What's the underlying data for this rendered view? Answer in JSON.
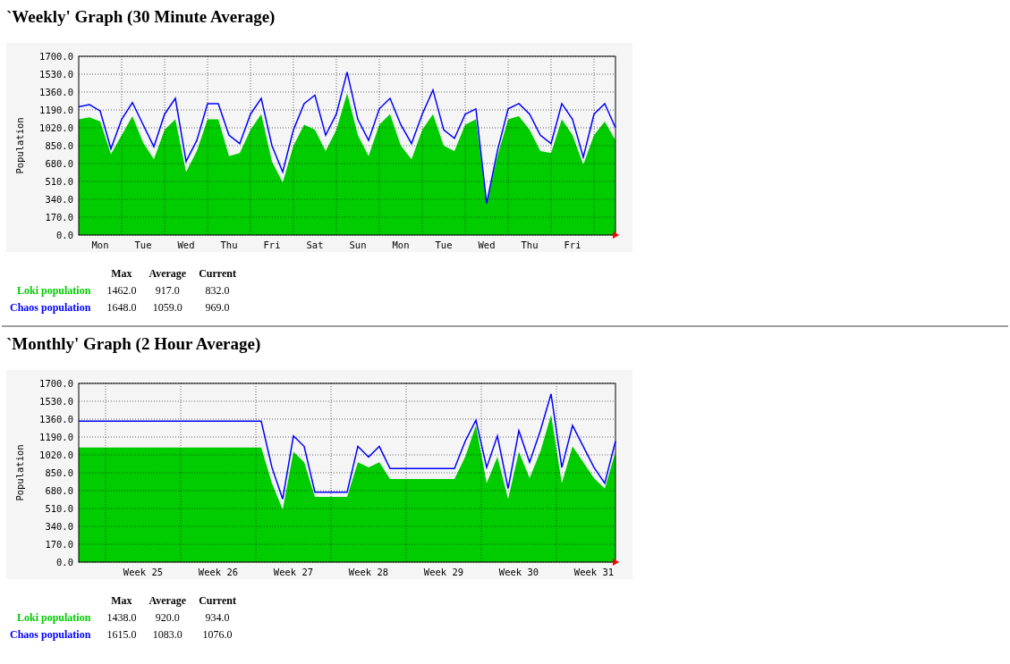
{
  "sections": [
    {
      "title": "`Weekly' Graph (30 Minute Average)",
      "chart_data": {
        "type": "area",
        "ylabel": "Population",
        "ylim": [
          0,
          1700
        ],
        "categories": [
          null,
          null,
          "Mon",
          null,
          null,
          null,
          "Tue",
          null,
          null,
          null,
          "Wed",
          null,
          null,
          null,
          "Thu",
          null,
          null,
          null,
          "Fri",
          null,
          null,
          null,
          "Sat",
          null,
          null,
          null,
          "Sun",
          null,
          null,
          null,
          "Mon",
          null,
          null,
          null,
          "Tue",
          null,
          null,
          null,
          "Wed",
          null,
          null,
          null,
          "Thu",
          null,
          null,
          null,
          "Fri",
          null,
          null,
          null,
          null
        ],
        "yticks": [
          {
            "value": 0,
            "label": "0.0"
          },
          {
            "value": 170,
            "label": "170.0"
          },
          {
            "value": 340,
            "label": "340.0"
          },
          {
            "value": 510,
            "label": "510.0"
          },
          {
            "value": 680,
            "label": "680.0"
          },
          {
            "value": 850,
            "label": "850.0"
          },
          {
            "value": 1020,
            "label": "1020.0"
          },
          {
            "value": 1190,
            "label": "1190.0"
          },
          {
            "value": 1360,
            "label": "1360.0"
          },
          {
            "value": 1530,
            "label": "1530.0"
          },
          {
            "value": 1700,
            "label": "1700.0"
          }
        ],
        "series": [
          {
            "type": "area",
            "color": "#00cc00",
            "values": [
              1100,
              1120,
              1080,
              770,
              950,
              1130,
              880,
              720,
              1000,
              1100,
              600,
              800,
              1100,
              1100,
              750,
              780,
              1000,
              1150,
              700,
              500,
              850,
              1050,
              1000,
              800,
              1000,
              1350,
              950,
              750,
              1050,
              1150,
              850,
              720,
              1000,
              1150,
              850,
              800,
              1050,
              1100,
              300,
              750,
              1100,
              1130,
              1000,
              800,
              780,
              1100,
              950,
              670,
              950,
              1080,
              900
            ]
          },
          {
            "type": "line",
            "color": "#0000ff",
            "values": [
              1220,
              1240,
              1180,
              820,
              1100,
              1260,
              1050,
              840,
              1150,
              1300,
              700,
              900,
              1250,
              1250,
              950,
              870,
              1150,
              1300,
              850,
              600,
              1000,
              1250,
              1330,
              950,
              1150,
              1550,
              1100,
              900,
              1200,
              1300,
              1050,
              870,
              1150,
              1380,
              1000,
              920,
              1150,
              1200,
              300,
              800,
              1200,
              1250,
              1150,
              950,
              870,
              1250,
              1100,
              740,
              1150,
              1250,
              1020
            ]
          }
        ],
        "grid": true
      },
      "legend": {
        "columns": [
          "Max",
          "Average",
          "Current"
        ],
        "rows": [
          {
            "label": "Loki population",
            "color": "#00cc00",
            "cells": [
              "1462.0",
              "917.0",
              "832.0"
            ]
          },
          {
            "label": "Chaos population",
            "color": "#0000ff",
            "cells": [
              "1648.0",
              "1059.0",
              "969.0"
            ]
          }
        ]
      }
    },
    {
      "title": "`Monthly' Graph (2 Hour Average)",
      "chart_data": {
        "type": "area",
        "ylabel": "Population",
        "ylim": [
          0,
          1700
        ],
        "categories": [
          null,
          null,
          null,
          null,
          null,
          null,
          "Week 25",
          null,
          null,
          null,
          null,
          null,
          null,
          "Week 26",
          null,
          null,
          null,
          null,
          null,
          null,
          "Week 27",
          null,
          null,
          null,
          null,
          null,
          null,
          "Week 28",
          null,
          null,
          null,
          null,
          null,
          null,
          "Week 29",
          null,
          null,
          null,
          null,
          null,
          null,
          "Week 30",
          null,
          null,
          null,
          null,
          null,
          null,
          "Week 31",
          null,
          null
        ],
        "yticks": [
          {
            "value": 0,
            "label": "0.0"
          },
          {
            "value": 170,
            "label": "170.0"
          },
          {
            "value": 340,
            "label": "340.0"
          },
          {
            "value": 510,
            "label": "510.0"
          },
          {
            "value": 680,
            "label": "680.0"
          },
          {
            "value": 850,
            "label": "850.0"
          },
          {
            "value": 1020,
            "label": "1020.0"
          },
          {
            "value": 1190,
            "label": "1190.0"
          },
          {
            "value": 1360,
            "label": "1360.0"
          },
          {
            "value": 1530,
            "label": "1530.0"
          },
          {
            "value": 1700,
            "label": "1700.0"
          }
        ],
        "series": [
          {
            "type": "area",
            "color": "#00cc00",
            "values": [
              1090,
              1090,
              1090,
              1090,
              1090,
              1090,
              1090,
              1090,
              1090,
              1090,
              1090,
              1090,
              1090,
              1090,
              1090,
              1090,
              1090,
              1090,
              750,
              500,
              1050,
              950,
              620,
              620,
              620,
              620,
              950,
              900,
              950,
              790,
              790,
              790,
              790,
              790,
              790,
              790,
              1000,
              1300,
              750,
              1000,
              600,
              1050,
              800,
              1050,
              1400,
              750,
              1100,
              950,
              800,
              700,
              1050
            ]
          },
          {
            "type": "line",
            "color": "#0000ff",
            "values": [
              1340,
              1340,
              1340,
              1340,
              1340,
              1340,
              1340,
              1340,
              1340,
              1340,
              1340,
              1340,
              1340,
              1340,
              1340,
              1340,
              1340,
              1340,
              900,
              600,
              1200,
              1100,
              665,
              665,
              665,
              665,
              1100,
              1000,
              1100,
              890,
              890,
              890,
              890,
              890,
              890,
              890,
              1150,
              1350,
              900,
              1200,
              700,
              1250,
              950,
              1250,
              1600,
              900,
              1300,
              1100,
              900,
              750,
              1150
            ]
          }
        ],
        "grid": true
      },
      "legend": {
        "columns": [
          "Max",
          "Average",
          "Current"
        ],
        "rows": [
          {
            "label": "Loki population",
            "color": "#00cc00",
            "cells": [
              "1438.0",
              "920.0",
              "934.0"
            ]
          },
          {
            "label": "Chaos population",
            "color": "#0000ff",
            "cells": [
              "1615.0",
              "1083.0",
              "1076.0"
            ]
          }
        ]
      }
    }
  ]
}
